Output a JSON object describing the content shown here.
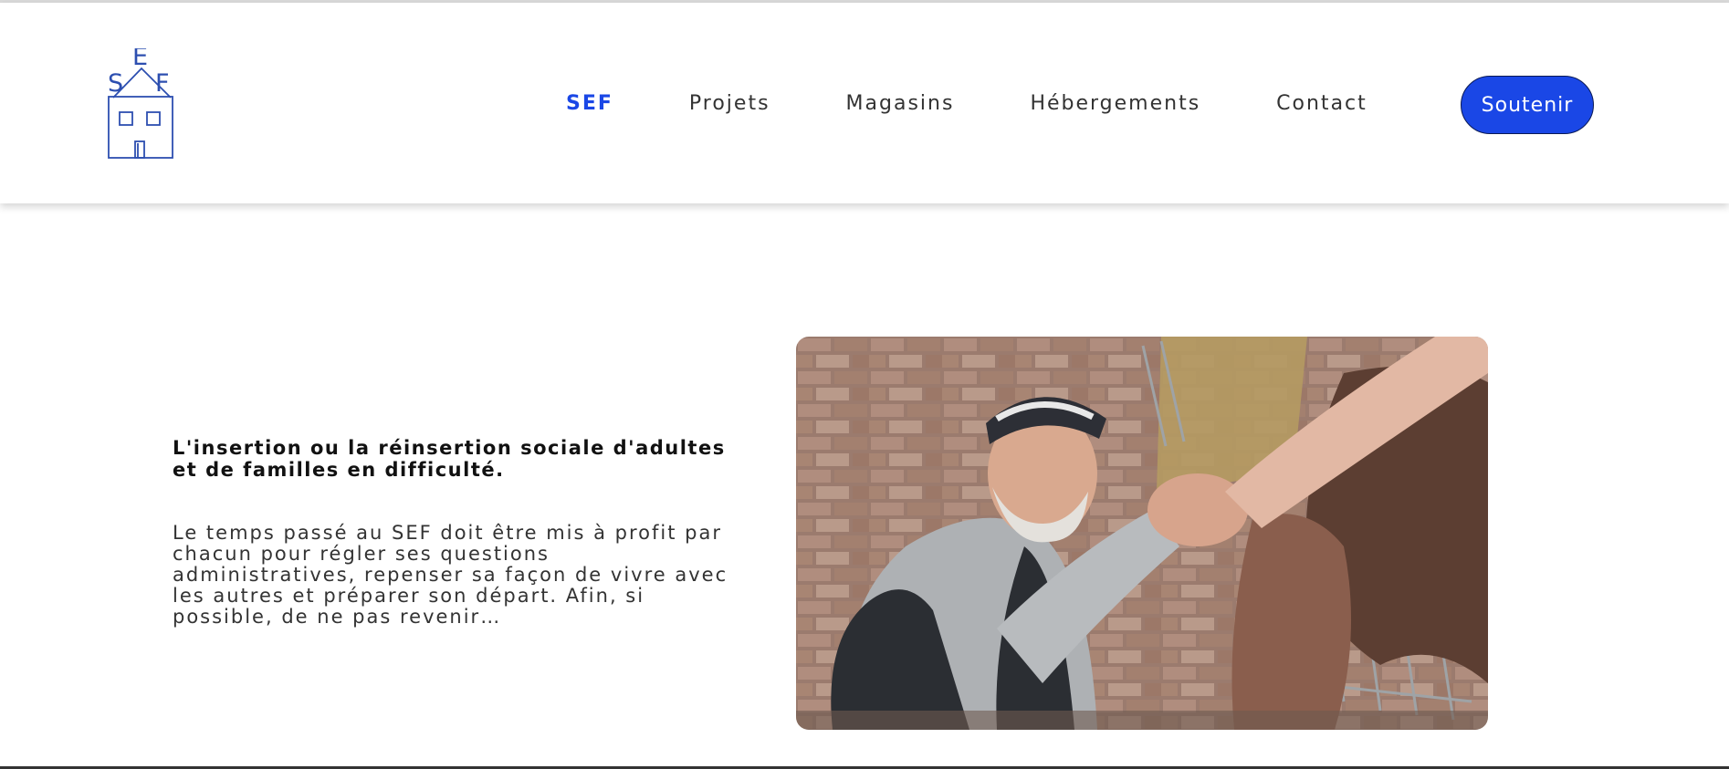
{
  "header": {
    "logo_text": "SEF",
    "nav": [
      {
        "label": "SEF",
        "active": true
      },
      {
        "label": "Projets",
        "active": false
      },
      {
        "label": "Magasins",
        "active": false
      },
      {
        "label": "Hébergements",
        "active": false
      },
      {
        "label": "Contact",
        "active": false
      }
    ],
    "cta_label": "Soutenir"
  },
  "main": {
    "headline": "L'insertion ou la réinsertion sociale d'adultes et de familles en difficulté.",
    "paragraph": "Le temps passé au SEF doit être mis à profit par chacun pour régler ses questions administratives, repenser sa façon de vivre avec les autres et préparer son départ. Afin, si possible, de ne pas revenir…"
  },
  "colors": {
    "accent": "#1a47e6",
    "logo": "#2d4fb0",
    "text": "#333333"
  }
}
